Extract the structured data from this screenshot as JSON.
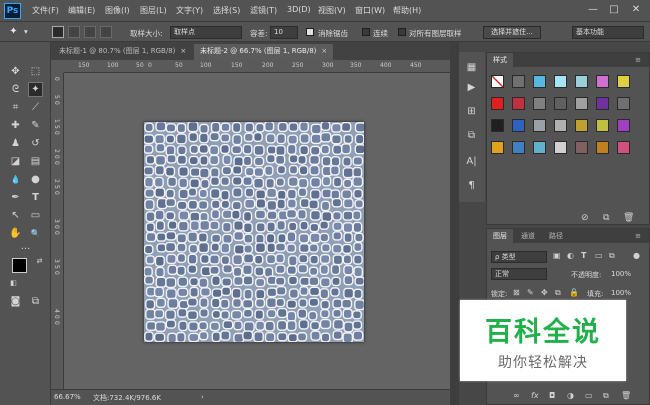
{
  "app": {
    "logo": "Ps"
  },
  "menu": {
    "items": [
      "文件(F)",
      "编辑(E)",
      "图像(I)",
      "图层(L)",
      "文字(Y)",
      "选择(S)",
      "滤镜(T)",
      "3D(D)",
      "视图(V)",
      "窗口(W)",
      "帮助(H)"
    ],
    "window_controls": {
      "minimize": "—",
      "maximize": "□",
      "close": "✕"
    }
  },
  "options_bar": {
    "sample_size_label": "取样大小:",
    "sample_size_value": "取样点",
    "tolerance_label": "容差:",
    "tolerance_value": "10",
    "anti_alias_label": "消除锯齿",
    "anti_alias_checked": true,
    "contiguous_label": "连续",
    "contiguous_checked": false,
    "all_layers_label": "对所有图层取样",
    "all_layers_checked": false,
    "select_mask_button": "选择并遮住...",
    "workspace_value": "基本功能"
  },
  "tabs": [
    {
      "title": "未标题-1 @ 80.7% (图层 1, RGB/8)",
      "close": "×",
      "active": false
    },
    {
      "title": "未标题-2 @ 66.7% (图层 1, RGB/8)",
      "close": "×",
      "active": true
    }
  ],
  "ruler": {
    "h_ticks": [
      "150",
      "100",
      "50",
      "0",
      "50",
      "100",
      "150",
      "200",
      "250",
      "300",
      "350",
      "400",
      "450"
    ],
    "v_ticks": [
      "0",
      "5",
      "0",
      "1",
      "5",
      "0",
      "2",
      "0",
      "0",
      "2",
      "5",
      "0",
      "3",
      "0",
      "0",
      "3",
      "5",
      "0",
      "4",
      "0",
      "0"
    ]
  },
  "status": {
    "zoom": "66.67%",
    "doc_info": "文档:732.4K/976.6K",
    "arrow": "›"
  },
  "styles_panel": {
    "tab_label": "样式",
    "swatch_colors": [
      [
        "#f2f2f2",
        "#707070",
        "#58b8e0",
        "#a6e3f5",
        "#9ad0dc",
        "#d070d0",
        "#e0d040"
      ],
      [
        "#e02020",
        "#c03040",
        "#808080",
        "#606060",
        "#a0a0a0",
        "#7030a0",
        "#707070"
      ],
      [
        "#202020",
        "#3060c0",
        "#9aa0a8",
        "#b0b0b0",
        "#c0a030",
        "#c0c040",
        "#a040c0"
      ],
      [
        "#e0a020",
        "#4080c0",
        "#60b0d0",
        "#d0d0d0",
        "#806060",
        "#c08020",
        "#d05080"
      ]
    ]
  },
  "layers_panel": {
    "tabs": [
      "图层",
      "通道",
      "路径"
    ],
    "filter_label": "ρ 类型",
    "blend_mode": "正常",
    "opacity_label": "不透明度:",
    "opacity_value": "100%",
    "lock_label": "锁定:",
    "fill_label": "填充:",
    "fill_value": "100%"
  },
  "watermark": {
    "title": "百科全说",
    "subtitle": "助你轻松解决"
  },
  "icons": {
    "magic_wand": "✦",
    "move": "✥",
    "marquee": "⬚",
    "lasso": "ᘓ",
    "crop": "⌗",
    "eyedropper": "⟋",
    "healing": "✚",
    "brush": "✎",
    "stamp": "♟",
    "history_brush": "↺",
    "eraser": "◪",
    "gradient": "▤",
    "blur": "💧",
    "dodge": "●",
    "pen": "✒",
    "type": "T",
    "path_select": "↖",
    "shape": "▭",
    "hand": "✋",
    "zoom": "🔍",
    "more": "···"
  }
}
